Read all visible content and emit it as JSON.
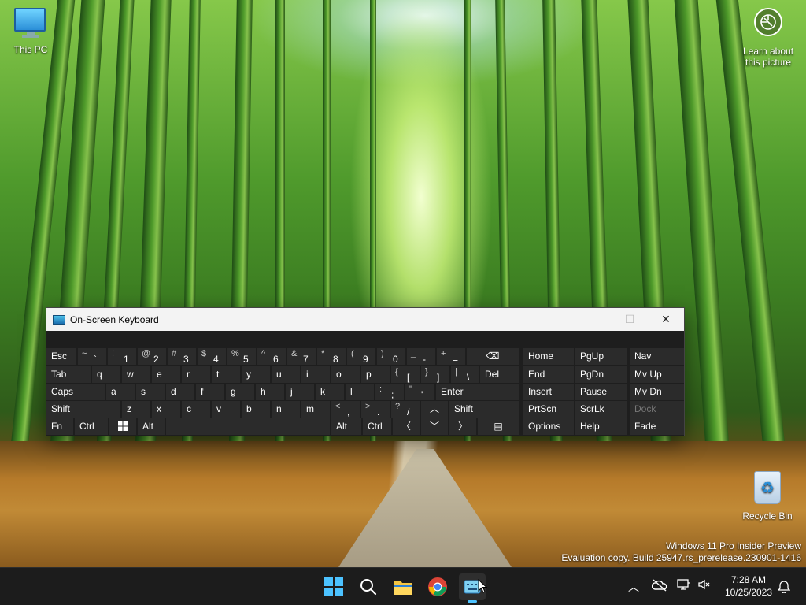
{
  "desktop": {
    "this_pc_label": "This PC",
    "learn_label_1": "Learn about",
    "learn_label_2": "this picture",
    "recycle_bin_label": "Recycle Bin",
    "watermark_line1": "Windows 11 Pro Insider Preview",
    "watermark_line2": "Evaluation copy. Build 25947.rs_prerelease.230901-1416"
  },
  "osk": {
    "title": "On-Screen Keyboard",
    "minimize_icon": "minimize-icon",
    "maximize_icon": "maximize-icon",
    "close_icon": "close-icon",
    "row1": {
      "esc": "Esc",
      "keys": [
        {
          "s": "~",
          "b": "`"
        },
        {
          "s": "!",
          "b": "1"
        },
        {
          "s": "@",
          "b": "2"
        },
        {
          "s": "#",
          "b": "3"
        },
        {
          "s": "$",
          "b": "4"
        },
        {
          "s": "%",
          "b": "5"
        },
        {
          "s": "^",
          "b": "6"
        },
        {
          "s": "&",
          "b": "7"
        },
        {
          "s": "*",
          "b": "8"
        },
        {
          "s": "(",
          "b": "9"
        },
        {
          "s": ")",
          "b": "0"
        },
        {
          "s": "_",
          "b": "-"
        },
        {
          "s": "+",
          "b": "="
        }
      ]
    },
    "row2": {
      "tab": "Tab",
      "letters": [
        "q",
        "w",
        "e",
        "r",
        "t",
        "y",
        "u",
        "i",
        "o",
        "p"
      ],
      "brackets": [
        {
          "s": "{",
          "b": "["
        },
        {
          "s": "}",
          "b": "]"
        },
        {
          "s": "|",
          "b": "\\"
        }
      ],
      "del": "Del"
    },
    "row3": {
      "caps": "Caps",
      "letters": [
        "a",
        "s",
        "d",
        "f",
        "g",
        "h",
        "j",
        "k",
        "l"
      ],
      "punct": [
        {
          "s": ":",
          "b": ";"
        },
        {
          "s": "\"",
          "b": "'"
        }
      ],
      "enter": "Enter"
    },
    "row4": {
      "shift": "Shift",
      "letters": [
        "z",
        "x",
        "c",
        "v",
        "b",
        "n",
        "m"
      ],
      "punct": [
        {
          "s": "<",
          "b": ","
        },
        {
          "s": ">",
          "b": "."
        },
        {
          "s": "?",
          "b": "/"
        }
      ],
      "shift_right": "Shift"
    },
    "row5": {
      "fn": "Fn",
      "ctrl": "Ctrl",
      "alt": "Alt",
      "alt_right": "Alt",
      "ctrl_right": "Ctrl"
    },
    "nav": {
      "home": "Home",
      "pgup": "PgUp",
      "nav": "Nav",
      "end": "End",
      "pgdn": "PgDn",
      "mvup": "Mv Up",
      "insert": "Insert",
      "pause": "Pause",
      "mvdn": "Mv Dn",
      "prtscn": "PrtScn",
      "scrlk": "ScrLk",
      "dock": "Dock",
      "options": "Options",
      "help": "Help",
      "fade": "Fade"
    }
  },
  "taskbar": {
    "time": "7:28 AM",
    "date": "10/25/2023",
    "icons": [
      "start-icon",
      "search-icon",
      "file-explorer-icon",
      "chrome-icon",
      "osk-taskbar-icon"
    ]
  }
}
